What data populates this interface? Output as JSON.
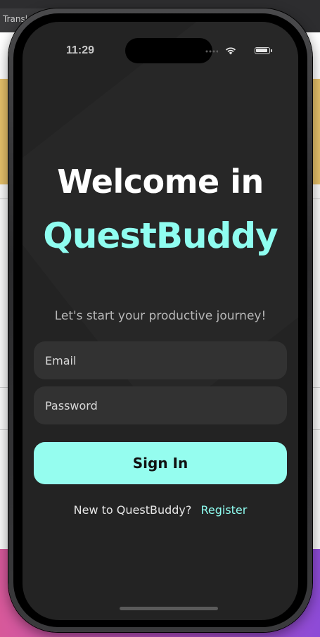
{
  "background": {
    "tab_label": "Transl"
  },
  "status_bar": {
    "time": "11:29",
    "icons": [
      "signal-icon",
      "wifi-icon",
      "battery-icon"
    ]
  },
  "login": {
    "title_line1": "Welcome in",
    "title_line2": "QuestBuddy",
    "subtitle": "Let's start your productive journey!",
    "email_placeholder": "Email",
    "password_placeholder": "Password",
    "sign_in_label": "Sign In",
    "register_prompt": "New to QuestBuddy?",
    "register_link": "Register"
  },
  "colors": {
    "accent": "#8ffdf0",
    "button": "#95fdef",
    "screen_bg": "#232323",
    "field_bg": "#323232"
  }
}
